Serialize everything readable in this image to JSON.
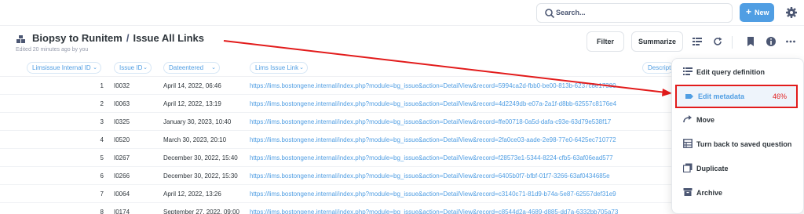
{
  "topbar": {
    "search_placeholder": "Search...",
    "new_label": "New",
    "new_plus": "+"
  },
  "header": {
    "collection": "Biopsy to Runitem",
    "separator": "/",
    "question_title": "Issue All Links",
    "edited_text": "Edited 20 minutes ago by you",
    "filter_label": "Filter",
    "summarize_label": "Summarize"
  },
  "table": {
    "columns": [
      "Limsissue Internal ID",
      "Issue ID",
      "Dateentered",
      "Lims Issue Link",
      "Descripti"
    ],
    "rows": [
      {
        "idx": "1",
        "issue": "I0032",
        "date": "April 14, 2022, 06:46",
        "link": "https://lims.bostongene.internal/index.php?module=bg_issue&action=DetailView&record=5994ca2d-fbb0-be00-813b-6237c8e17380"
      },
      {
        "idx": "2",
        "issue": "I0063",
        "date": "April 12, 2022, 13:19",
        "link": "https://lims.bostongene.internal/index.php?module=bg_issue&action=DetailView&record=4d2249db-e07a-2a1f-d8bb-62557c8176e4"
      },
      {
        "idx": "3",
        "issue": "I0325",
        "date": "January 30, 2023, 10:40",
        "link": "https://lims.bostongene.internal/index.php?module=bg_issue&action=DetailView&record=ffe00718-0a5d-dafa-c93e-63d79e538f17"
      },
      {
        "idx": "4",
        "issue": "I0520",
        "date": "March 30, 2023, 20:10",
        "link": "https://lims.bostongene.internal/index.php?module=bg_issue&action=DetailView&record=2fa0ce03-aade-2e98-77e0-6425ec710772"
      },
      {
        "idx": "5",
        "issue": "I0267",
        "date": "December 30, 2022, 15:40",
        "link": "https://lims.bostongene.internal/index.php?module=bg_issue&action=DetailView&record=f28573e1-5344-8224-cfb5-63af06ead577"
      },
      {
        "idx": "6",
        "issue": "I0266",
        "date": "December 30, 2022, 15:30",
        "link": "https://lims.bostongene.internal/index.php?module=bg_issue&action=DetailView&record=6405b0f7-bfbf-01f7-3266-63af0434685e"
      },
      {
        "idx": "7",
        "issue": "I0064",
        "date": "April 12, 2022, 13:26",
        "link": "https://lims.bostongene.internal/index.php?module=bg_issue&action=DetailView&record=c3140c71-81d9-b74a-5e87-62557def31e9"
      },
      {
        "idx": "8",
        "issue": "I0174",
        "date": "September 27, 2022, 09:00",
        "link": "https://lims.bostongene.internal/index.php?module=bg_issue&action=DetailView&record=c8544d2a-4689-d885-dd7a-6332bb705a73"
      }
    ]
  },
  "menu": {
    "items": [
      {
        "label": "Edit query definition",
        "icon": "notebook-icon"
      },
      {
        "label": "Edit metadata",
        "icon": "label-icon",
        "percent": "46%"
      },
      {
        "label": "Move",
        "icon": "move-arrow-icon"
      },
      {
        "label": "Turn back to saved question",
        "icon": "table-icon"
      },
      {
        "label": "Duplicate",
        "icon": "duplicate-icon"
      },
      {
        "label": "Archive",
        "icon": "archive-icon"
      }
    ]
  },
  "colors": {
    "brand": "#509ee3",
    "annotation": "#e21b1b",
    "text_dark": "#2e353b"
  }
}
